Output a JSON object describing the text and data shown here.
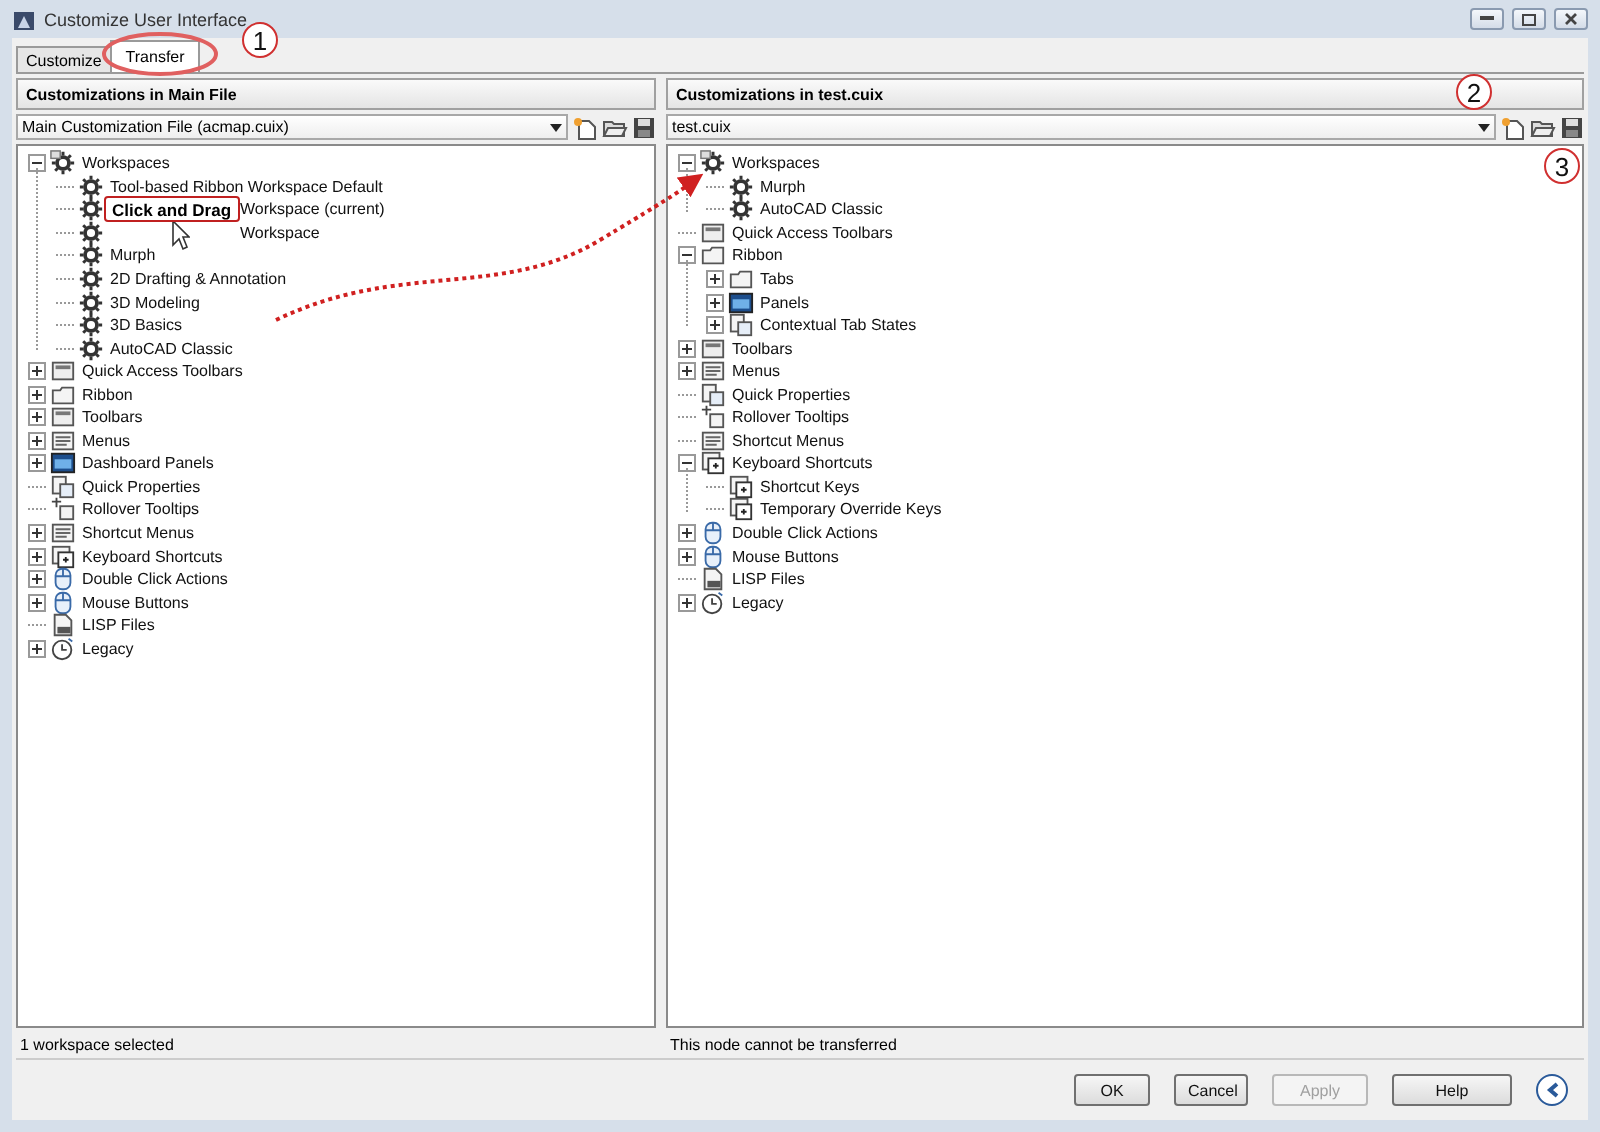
{
  "window": {
    "title": "Customize User Interface"
  },
  "tabs": [
    {
      "label": "Customize",
      "selected": false
    },
    {
      "label": "Transfer",
      "selected": true
    }
  ],
  "annotations": [
    {
      "number": "1"
    },
    {
      "number": "2"
    },
    {
      "number": "3"
    }
  ],
  "callout": {
    "text": "Click and Drag"
  },
  "panels": [
    {
      "header": "Customizations in Main File",
      "file": "Main Customization File (acmap.cuix)",
      "status": "1 workspace selected",
      "tree": [
        {
          "label": "Workspaces",
          "kind": "workspaces",
          "expanded": true,
          "children": [
            {
              "label": "Tool-based Ribbon Workspace Default",
              "kind": "workspace"
            },
            {
              "label": "Workspace (current)",
              "kind": "workspace",
              "covered": true
            },
            {
              "label": "Workspace",
              "kind": "workspace",
              "covered": true
            },
            {
              "label": "Murph",
              "kind": "workspace"
            },
            {
              "label": "2D Drafting & Annotation",
              "kind": "workspace"
            },
            {
              "label": "3D Modeling",
              "kind": "workspace"
            },
            {
              "label": "3D Basics",
              "kind": "workspace"
            },
            {
              "label": "AutoCAD Classic",
              "kind": "workspace"
            }
          ]
        },
        {
          "label": "Quick Access Toolbars",
          "kind": "toolbar",
          "expanded": false
        },
        {
          "label": "Ribbon",
          "kind": "ribbon",
          "expanded": false
        },
        {
          "label": "Toolbars",
          "kind": "toolbar",
          "expanded": false
        },
        {
          "label": "Menus",
          "kind": "menu",
          "expanded": false
        },
        {
          "label": "Dashboard Panels",
          "kind": "dashboard",
          "expanded": false
        },
        {
          "label": "Quick Properties",
          "kind": "properties"
        },
        {
          "label": "Rollover Tooltips",
          "kind": "tooltip"
        },
        {
          "label": "Shortcut Menus",
          "kind": "menu",
          "expanded": false
        },
        {
          "label": "Keyboard Shortcuts",
          "kind": "keyboard",
          "expanded": false
        },
        {
          "label": "Double Click Actions",
          "kind": "mouse",
          "expanded": false
        },
        {
          "label": "Mouse Buttons",
          "kind": "mouse",
          "expanded": false
        },
        {
          "label": "LISP Files",
          "kind": "file"
        },
        {
          "label": "Legacy",
          "kind": "legacy",
          "expanded": false
        }
      ]
    },
    {
      "header": "Customizations in test.cuix",
      "file": "test.cuix",
      "status": "This node cannot be transferred",
      "tree": [
        {
          "label": "Workspaces",
          "kind": "workspaces",
          "expanded": true,
          "children": [
            {
              "label": "Murph",
              "kind": "workspace"
            },
            {
              "label": "AutoCAD Classic",
              "kind": "workspace"
            }
          ]
        },
        {
          "label": "Quick Access Toolbars",
          "kind": "toolbar"
        },
        {
          "label": "Ribbon",
          "kind": "ribbon",
          "expanded": true,
          "children": [
            {
              "label": "Tabs",
              "kind": "ribbon",
              "expanded": false
            },
            {
              "label": "Panels",
              "kind": "dashboard",
              "expanded": false
            },
            {
              "label": "Contextual Tab States",
              "kind": "properties",
              "expanded": false
            }
          ]
        },
        {
          "label": "Toolbars",
          "kind": "toolbar",
          "expanded": false
        },
        {
          "label": "Menus",
          "kind": "menu",
          "expanded": false
        },
        {
          "label": "Quick Properties",
          "kind": "properties"
        },
        {
          "label": "Rollover Tooltips",
          "kind": "tooltip"
        },
        {
          "label": "Shortcut Menus",
          "kind": "menu"
        },
        {
          "label": "Keyboard Shortcuts",
          "kind": "keyboard",
          "expanded": true,
          "children": [
            {
              "label": "Shortcut Keys",
              "kind": "keyboard"
            },
            {
              "label": "Temporary Override Keys",
              "kind": "keyboard"
            }
          ]
        },
        {
          "label": "Double Click Actions",
          "kind": "mouse",
          "expanded": false
        },
        {
          "label": "Mouse Buttons",
          "kind": "mouse",
          "expanded": false
        },
        {
          "label": "LISP Files",
          "kind": "file"
        },
        {
          "label": "Legacy",
          "kind": "legacy",
          "expanded": false
        }
      ]
    }
  ],
  "buttons": [
    {
      "label": "OK",
      "disabled": false
    },
    {
      "label": "Cancel",
      "disabled": false
    },
    {
      "label": "Apply",
      "disabled": true
    },
    {
      "label": "Help",
      "disabled": false
    }
  ]
}
